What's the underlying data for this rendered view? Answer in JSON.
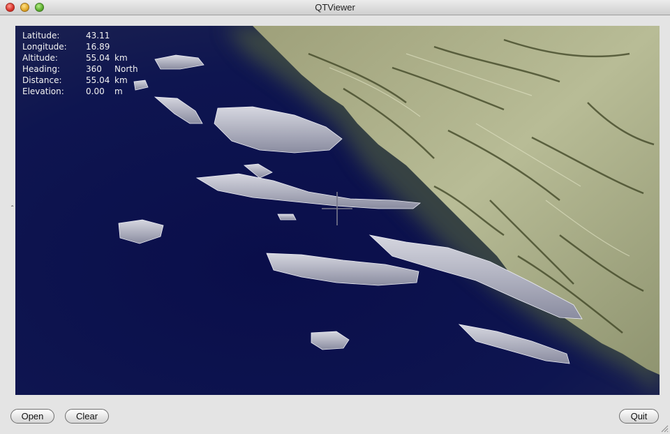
{
  "window": {
    "title": "QTViewer"
  },
  "hud": {
    "rows": [
      {
        "label": "Latitude:",
        "value": "43.11",
        "unit": ""
      },
      {
        "label": "Longitude:",
        "value": "16.89",
        "unit": ""
      },
      {
        "label": "Altitude:",
        "value": "55.04",
        "unit": "km"
      },
      {
        "label": "Heading:",
        "value": "360",
        "unit": "North"
      },
      {
        "label": "Distance:",
        "value": "55.04",
        "unit": "km"
      },
      {
        "label": "Elevation:",
        "value": "0.00",
        "unit": "m"
      }
    ]
  },
  "buttons": {
    "open": "Open",
    "clear": "Clear",
    "quit": "Quit"
  },
  "side_caret": "ˆ",
  "colors": {
    "sea": "#0c1148",
    "land": "#b9bd95",
    "land_dark": "#4a4f2a",
    "island": "#c8c8d0"
  }
}
